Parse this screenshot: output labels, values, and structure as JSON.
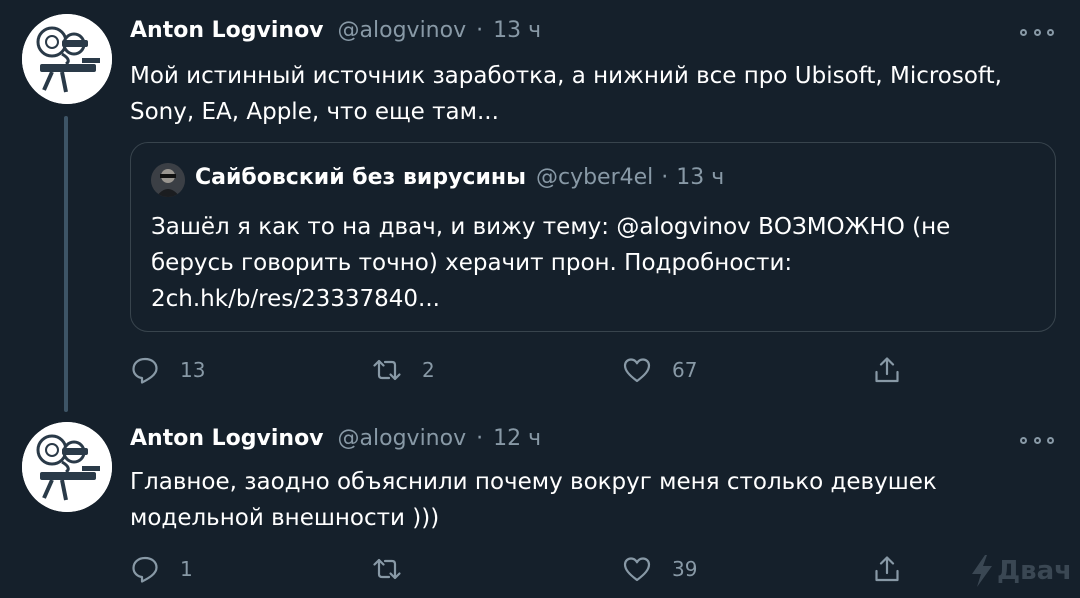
{
  "tweets": [
    {
      "name": "Anton Logvinov",
      "handle": "@alogvinov",
      "dot": "·",
      "time": "13 ч",
      "text_lines": [
        "Мой истинный источник заработка, а нижний все про Ubisoft, Microsoft,",
        "Sony, EA, Apple, что еще там..."
      ],
      "quote": {
        "name": "Сайбовский без вирусины",
        "handle": "@cyber4el",
        "dot": "·",
        "time": "13 ч",
        "text_lines": [
          "Зашёл я как то на двач, и вижу тему: @alogvinov ВОЗМОЖНО (не",
          "берусь говорить точно) херачит прон. Подробности:",
          "2ch.hk/b/res/23337840..."
        ]
      },
      "replies": "13",
      "retweets": "2",
      "likes": "67"
    },
    {
      "name": "Anton Logvinov",
      "handle": "@alogvinov",
      "dot": "·",
      "time": "12 ч",
      "text_lines": [
        "Главное, заодно объяснили почему вокруг меня столько девушек",
        "модельной внешности )))"
      ],
      "replies": "1",
      "retweets": "",
      "likes": "39"
    }
  ],
  "icons": {
    "reply": "reply-icon",
    "retweet": "retweet-icon",
    "like": "heart-icon",
    "share": "share-icon",
    "more": "more-icon"
  },
  "colors": {
    "background": "#15202b",
    "muted": "#8899a6",
    "border": "#38444d",
    "text": "#ffffff"
  },
  "watermark": "Двач"
}
